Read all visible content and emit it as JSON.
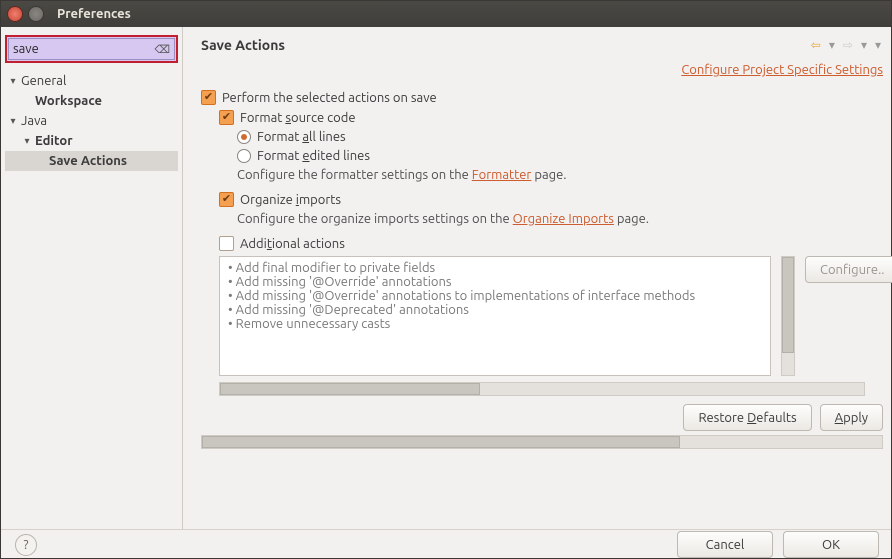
{
  "window": {
    "title": "Preferences"
  },
  "sidebar": {
    "search_value": "save",
    "items": [
      {
        "label": "General",
        "depth": 0,
        "bold": false,
        "expanded": true
      },
      {
        "label": "Workspace",
        "depth": 1,
        "bold": true,
        "expanded": false
      },
      {
        "label": "Java",
        "depth": 0,
        "bold": false,
        "expanded": true
      },
      {
        "label": "Editor",
        "depth": 1,
        "bold": true,
        "expanded": true
      },
      {
        "label": "Save Actions",
        "depth": 2,
        "bold": true,
        "selected": true
      }
    ]
  },
  "main": {
    "title": "Save Actions",
    "project_link": "Configure Project Specific Settings",
    "perform_label": "Perform the selected actions on save",
    "format_label_pre": "Format ",
    "format_label_u": "s",
    "format_label_post": "ource code",
    "format_all_pre": "Format ",
    "format_all_u": "a",
    "format_all_post": "ll lines",
    "format_edited_pre": "Format ",
    "format_edited_u": "e",
    "format_edited_post": "dited lines",
    "formatter_hint_pre": "Configure the formatter settings on the ",
    "formatter_link": "Formatter",
    "formatter_hint_post": " page.",
    "organize_label_pre": "Organize ",
    "organize_label_u": "i",
    "organize_label_post": "mports",
    "organize_hint_pre": "Configure the organize imports settings on the ",
    "organize_link": "Organize Imports",
    "organize_hint_post": " page.",
    "additional_label_pre": "Addi",
    "additional_label_u": "t",
    "additional_label_post": "ional actions",
    "additional_items": [
      "Add final modifier to private fields",
      "Add missing '@Override' annotations",
      "Add missing '@Override' annotations to implementations of interface methods",
      "Add missing '@Deprecated' annotations",
      "Remove unnecessary casts"
    ],
    "configure_btn": "Configure..",
    "restore_btn_pre": "Restore ",
    "restore_btn_u": "D",
    "restore_btn_post": "efaults",
    "apply_btn_u": "A",
    "apply_btn_post": "pply"
  },
  "footer": {
    "cancel": "Cancel",
    "ok": "OK"
  }
}
